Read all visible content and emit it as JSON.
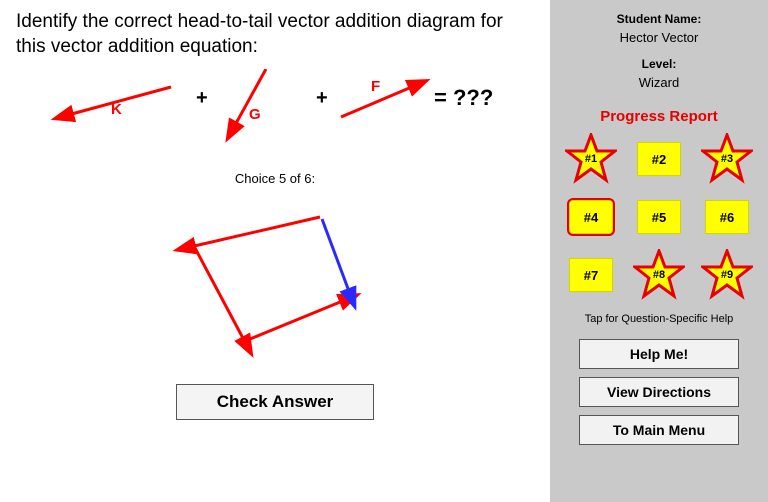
{
  "question": "Identify the correct head-to-tail vector addition diagram for this vector addition equation:",
  "equation": {
    "plus": "+",
    "equals": "=",
    "unknown": "???",
    "vectors": [
      "K",
      "G",
      "F"
    ]
  },
  "choice_label": "Choice 5 of 6:",
  "buttons": {
    "check": "Check Answer",
    "help": "Help Me!",
    "directions": "View Directions",
    "menu": "To Main Menu"
  },
  "sidebar": {
    "name_label": "Student Name:",
    "name_value": "Hector Vector",
    "level_label": "Level:",
    "level_value": "Wizard",
    "progress_title": "Progress Report",
    "help_hint": "Tap for Question-Specific Help"
  },
  "progress": [
    {
      "label": "#1",
      "star": true,
      "current": false
    },
    {
      "label": "#2",
      "star": false,
      "current": false
    },
    {
      "label": "#3",
      "star": true,
      "current": false
    },
    {
      "label": "#4",
      "star": false,
      "current": true
    },
    {
      "label": "#5",
      "star": false,
      "current": false
    },
    {
      "label": "#6",
      "star": false,
      "current": false
    },
    {
      "label": "#7",
      "star": false,
      "current": false
    },
    {
      "label": "#8",
      "star": true,
      "current": false
    },
    {
      "label": "#9",
      "star": true,
      "current": false
    }
  ]
}
